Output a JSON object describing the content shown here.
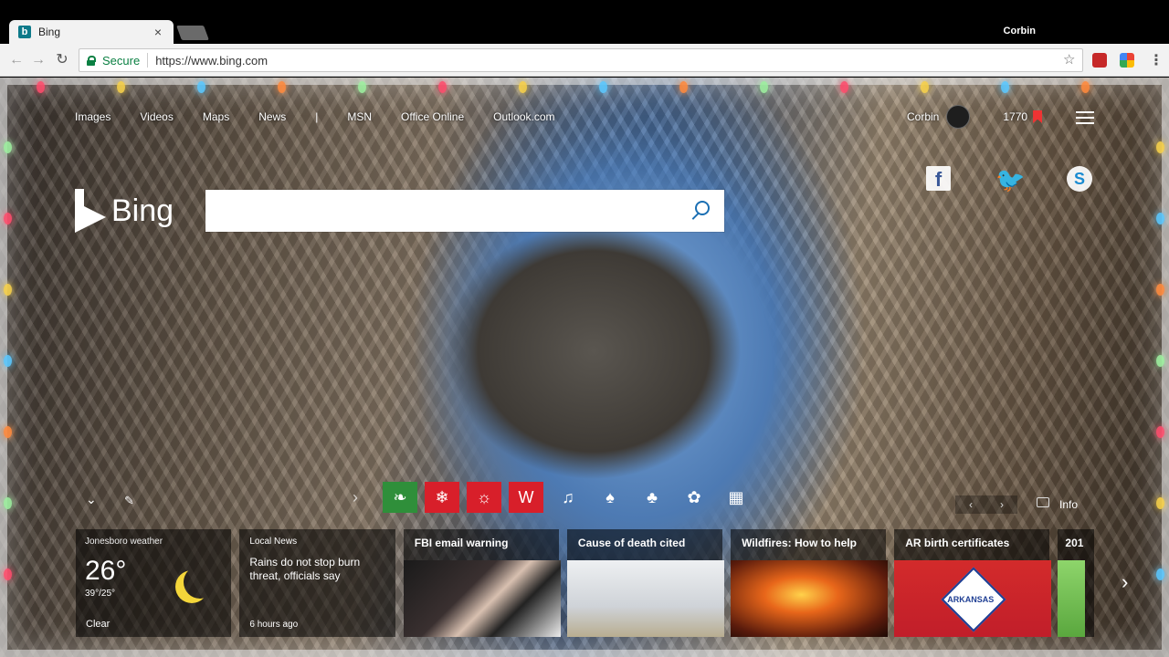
{
  "browser": {
    "tab_title": "Bing",
    "tab_close": "×",
    "profile_name": "Corbin",
    "secure_label": "Secure",
    "url": "https://www.bing.com"
  },
  "nav": {
    "links": [
      "Images",
      "Videos",
      "Maps",
      "News",
      "|",
      "MSN",
      "Office Online",
      "Outlook.com"
    ]
  },
  "user": {
    "name": "Corbin",
    "points": "1770"
  },
  "logo": {
    "text": "Bing"
  },
  "search": {
    "placeholder": ""
  },
  "strip": {
    "icons": [
      {
        "name": "leaf-icon",
        "glyph": "❧",
        "style": "green"
      },
      {
        "name": "snowflake-icon",
        "glyph": "❄",
        "style": "red"
      },
      {
        "name": "lightbulb-icon",
        "glyph": "☼",
        "style": "red"
      },
      {
        "name": "ornament-icon",
        "glyph": "W",
        "style": "red"
      },
      {
        "name": "bell-icon",
        "glyph": "♫",
        "style": "plain"
      },
      {
        "name": "candle-icon",
        "glyph": "♠",
        "style": "plain"
      },
      {
        "name": "stocking-icon",
        "glyph": "♣",
        "style": "plain"
      },
      {
        "name": "gift-exchange-icon",
        "glyph": "✿",
        "style": "plain"
      },
      {
        "name": "gift-icon",
        "glyph": "▦",
        "style": "plain"
      }
    ]
  },
  "image_info": {
    "label": "Info"
  },
  "weather": {
    "location": "Jonesboro weather",
    "temp": "26°",
    "range": "39°/25°",
    "condition": "Clear"
  },
  "local_news": {
    "label": "Local News",
    "title": "Rains do not stop burn threat, officials say",
    "time": "6 hours ago"
  },
  "news": [
    {
      "title": "FBI email warning"
    },
    {
      "title": "Cause of death cited"
    },
    {
      "title": "Wildfires: How to help"
    },
    {
      "title": "AR birth certificates"
    }
  ],
  "partial_tile": {
    "title": "201"
  },
  "flag": {
    "text": "ARKANSAS"
  },
  "colors": {
    "tile_bg": "#00000088",
    "accent_red": "#d81f2a",
    "accent_green": "#2f8f3a",
    "secure_green": "#0b8043"
  }
}
